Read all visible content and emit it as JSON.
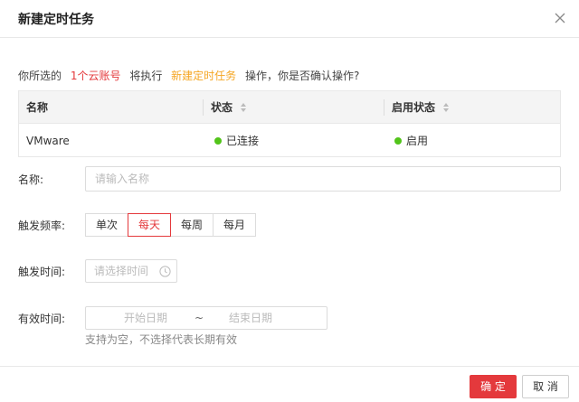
{
  "dialog": {
    "title": "新建定时任务"
  },
  "confirm": {
    "prefix": "你所选的",
    "count": "1个云账号",
    "middle": "将执行",
    "action": "新建定时任务",
    "suffix": "操作，你是否确认操作?"
  },
  "table": {
    "columns": [
      "名称",
      "状态",
      "启用状态"
    ],
    "rows": [
      {
        "name": "VMware",
        "status": "已连接",
        "enabled": "启用"
      }
    ],
    "status_color": "#52c41a"
  },
  "form": {
    "name_label": "名称:",
    "name_placeholder": "请输入名称",
    "freq_label": "触发频率:",
    "freq_options": [
      "单次",
      "每天",
      "每周",
      "每月"
    ],
    "freq_selected": "每天",
    "time_label": "触发时间:",
    "time_placeholder": "请选择时间",
    "valid_label": "有效时间:",
    "start_placeholder": "开始日期",
    "range_separator": "~",
    "end_placeholder": "结束日期",
    "valid_hint": "支持为空，不选择代表长期有效"
  },
  "footer": {
    "ok_label": "确 定",
    "cancel_label": "取 消"
  },
  "colors": {
    "accent": "#e4393c",
    "highlight": "#f5a623"
  }
}
